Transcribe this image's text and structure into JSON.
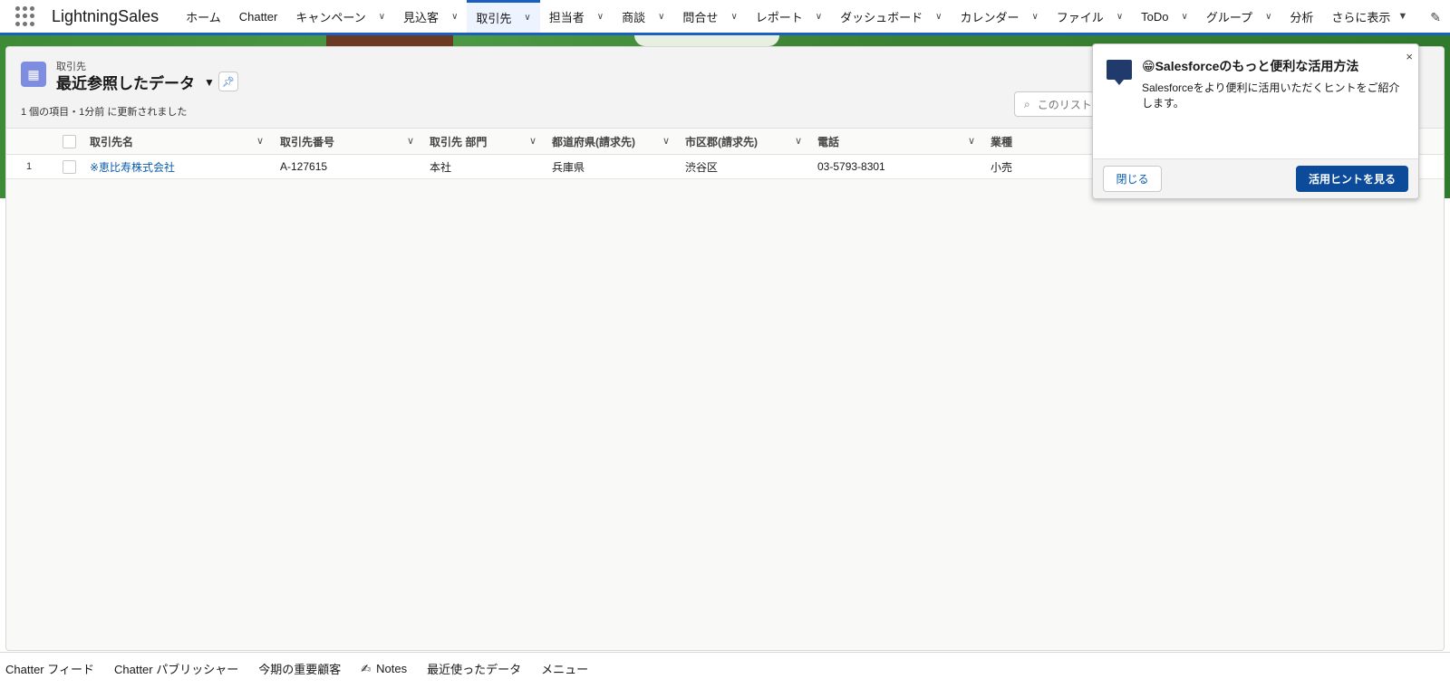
{
  "app": {
    "name": "LightningSales"
  },
  "nav": {
    "items": [
      {
        "label": "ホーム",
        "chevron": false
      },
      {
        "label": "Chatter",
        "chevron": false
      },
      {
        "label": "キャンペーン",
        "chevron": true
      },
      {
        "label": "見込客",
        "chevron": true
      },
      {
        "label": "取引先",
        "chevron": true,
        "active": true
      },
      {
        "label": "担当者",
        "chevron": true
      },
      {
        "label": "商談",
        "chevron": true
      },
      {
        "label": "問合せ",
        "chevron": true
      },
      {
        "label": "レポート",
        "chevron": true
      },
      {
        "label": "ダッシュボード",
        "chevron": true
      },
      {
        "label": "カレンダー",
        "chevron": true
      },
      {
        "label": "ファイル",
        "chevron": true
      },
      {
        "label": "ToDo",
        "chevron": true
      },
      {
        "label": "グループ",
        "chevron": true
      },
      {
        "label": "分析",
        "chevron": false
      }
    ],
    "more_label": "さらに表示",
    "accent_color": "#1b5fc1"
  },
  "list": {
    "object_label": "取引先",
    "view_title": "最近参照したデータ",
    "meta": "1 個の項目・1分前 に更新されました",
    "search_placeholder": "このリスト",
    "columns": [
      "取引先名",
      "取引先番号",
      "取引先 部門",
      "都道府県(請求先)",
      "市区郡(請求先)",
      "電話",
      "業種"
    ],
    "rows": [
      {
        "num": "1",
        "name": "※恵比寿株式会社",
        "number": "A-127615",
        "division": "本社",
        "prefecture": "兵庫県",
        "city": "渋谷区",
        "phone": "03-5793-8301",
        "industry": "小売"
      }
    ]
  },
  "popover": {
    "title": "😁Salesforceのもっと便利な活用方法",
    "body": "Salesforceをより便利に活用いただくヒントをご紹介します。",
    "close_label": "閉じる",
    "hint_label": "活用ヒントを見る",
    "close_icon": "×"
  },
  "utility": {
    "items": [
      {
        "label": "Chatter フィード"
      },
      {
        "label": "Chatter パブリッシャー"
      },
      {
        "label": "今期の重要顧客"
      },
      {
        "label": "Notes",
        "icon": "notes-icon"
      },
      {
        "label": "最近使ったデータ"
      },
      {
        "label": "メニュー"
      }
    ]
  }
}
